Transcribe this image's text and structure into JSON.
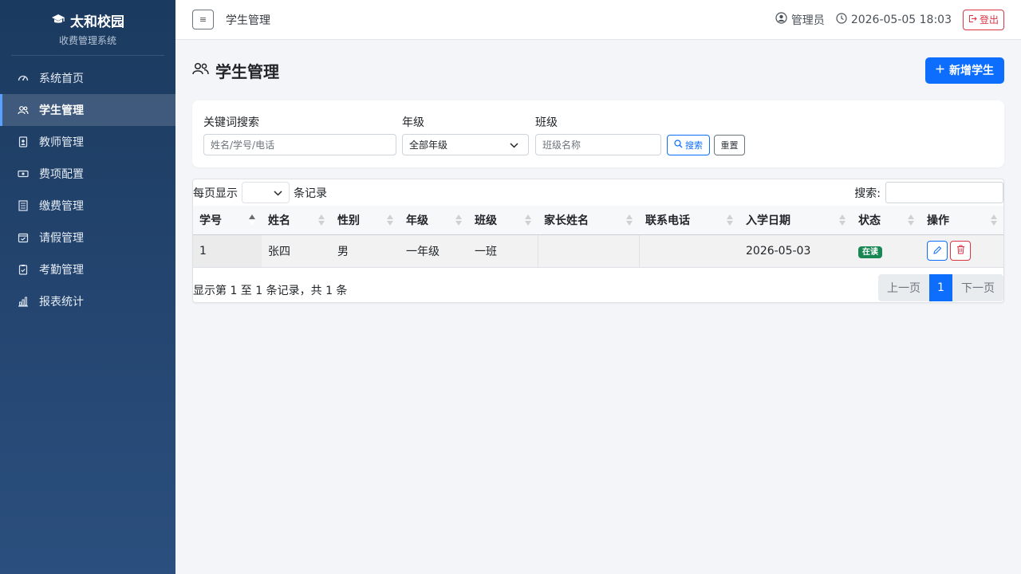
{
  "brand": {
    "title": "太和校园",
    "subtitle": "收费管理系统"
  },
  "sidebar": {
    "items": [
      {
        "label": "系统首页",
        "icon": "dashboard-icon",
        "active": false
      },
      {
        "label": "学生管理",
        "icon": "people-icon",
        "active": true
      },
      {
        "label": "教师管理",
        "icon": "badge-icon",
        "active": false
      },
      {
        "label": "费项配置",
        "icon": "cash-icon",
        "active": false
      },
      {
        "label": "缴费管理",
        "icon": "receipt-icon",
        "active": false
      },
      {
        "label": "请假管理",
        "icon": "calendar-check-icon",
        "active": false
      },
      {
        "label": "考勤管理",
        "icon": "clipboard-check-icon",
        "active": false
      },
      {
        "label": "报表统计",
        "icon": "bar-chart-icon",
        "active": false
      }
    ]
  },
  "topbar": {
    "menu_glyph": "≡",
    "title": "学生管理",
    "user": "管理员",
    "datetime": "2026-05-05 18:03",
    "logout": "登出"
  },
  "page": {
    "title": "学生管理",
    "add_button": "新增学生"
  },
  "filters": {
    "keyword_label": "关键词搜索",
    "keyword_placeholder": "姓名/学号/电话",
    "grade_label": "年级",
    "grade_value": "全部年级",
    "class_label": "班级",
    "class_placeholder": "班级名称",
    "search_button": "搜索",
    "reset_button": "重置"
  },
  "table": {
    "length_prefix": "每页显示",
    "length_suffix": "条记录",
    "search_label": "搜索:",
    "columns": [
      "学号",
      "姓名",
      "性别",
      "年级",
      "班级",
      "家长姓名",
      "联系电话",
      "入学日期",
      "状态",
      "操作"
    ],
    "rows": [
      {
        "id": "1",
        "name": "张四",
        "gender": "男",
        "grade": "一年级",
        "class": "一班",
        "parent": "",
        "phone": "",
        "date": "2026-05-03",
        "status": "在读"
      }
    ],
    "info": "显示第 1 至 1 条记录，共 1 条",
    "prev": "上一页",
    "page": "1",
    "next": "下一页"
  },
  "colors": {
    "primary": "#0d6efd",
    "danger": "#dc3545",
    "success": "#198754",
    "sidebar_top": "#1b3a5f",
    "sidebar_bottom": "#2b4f7e"
  }
}
